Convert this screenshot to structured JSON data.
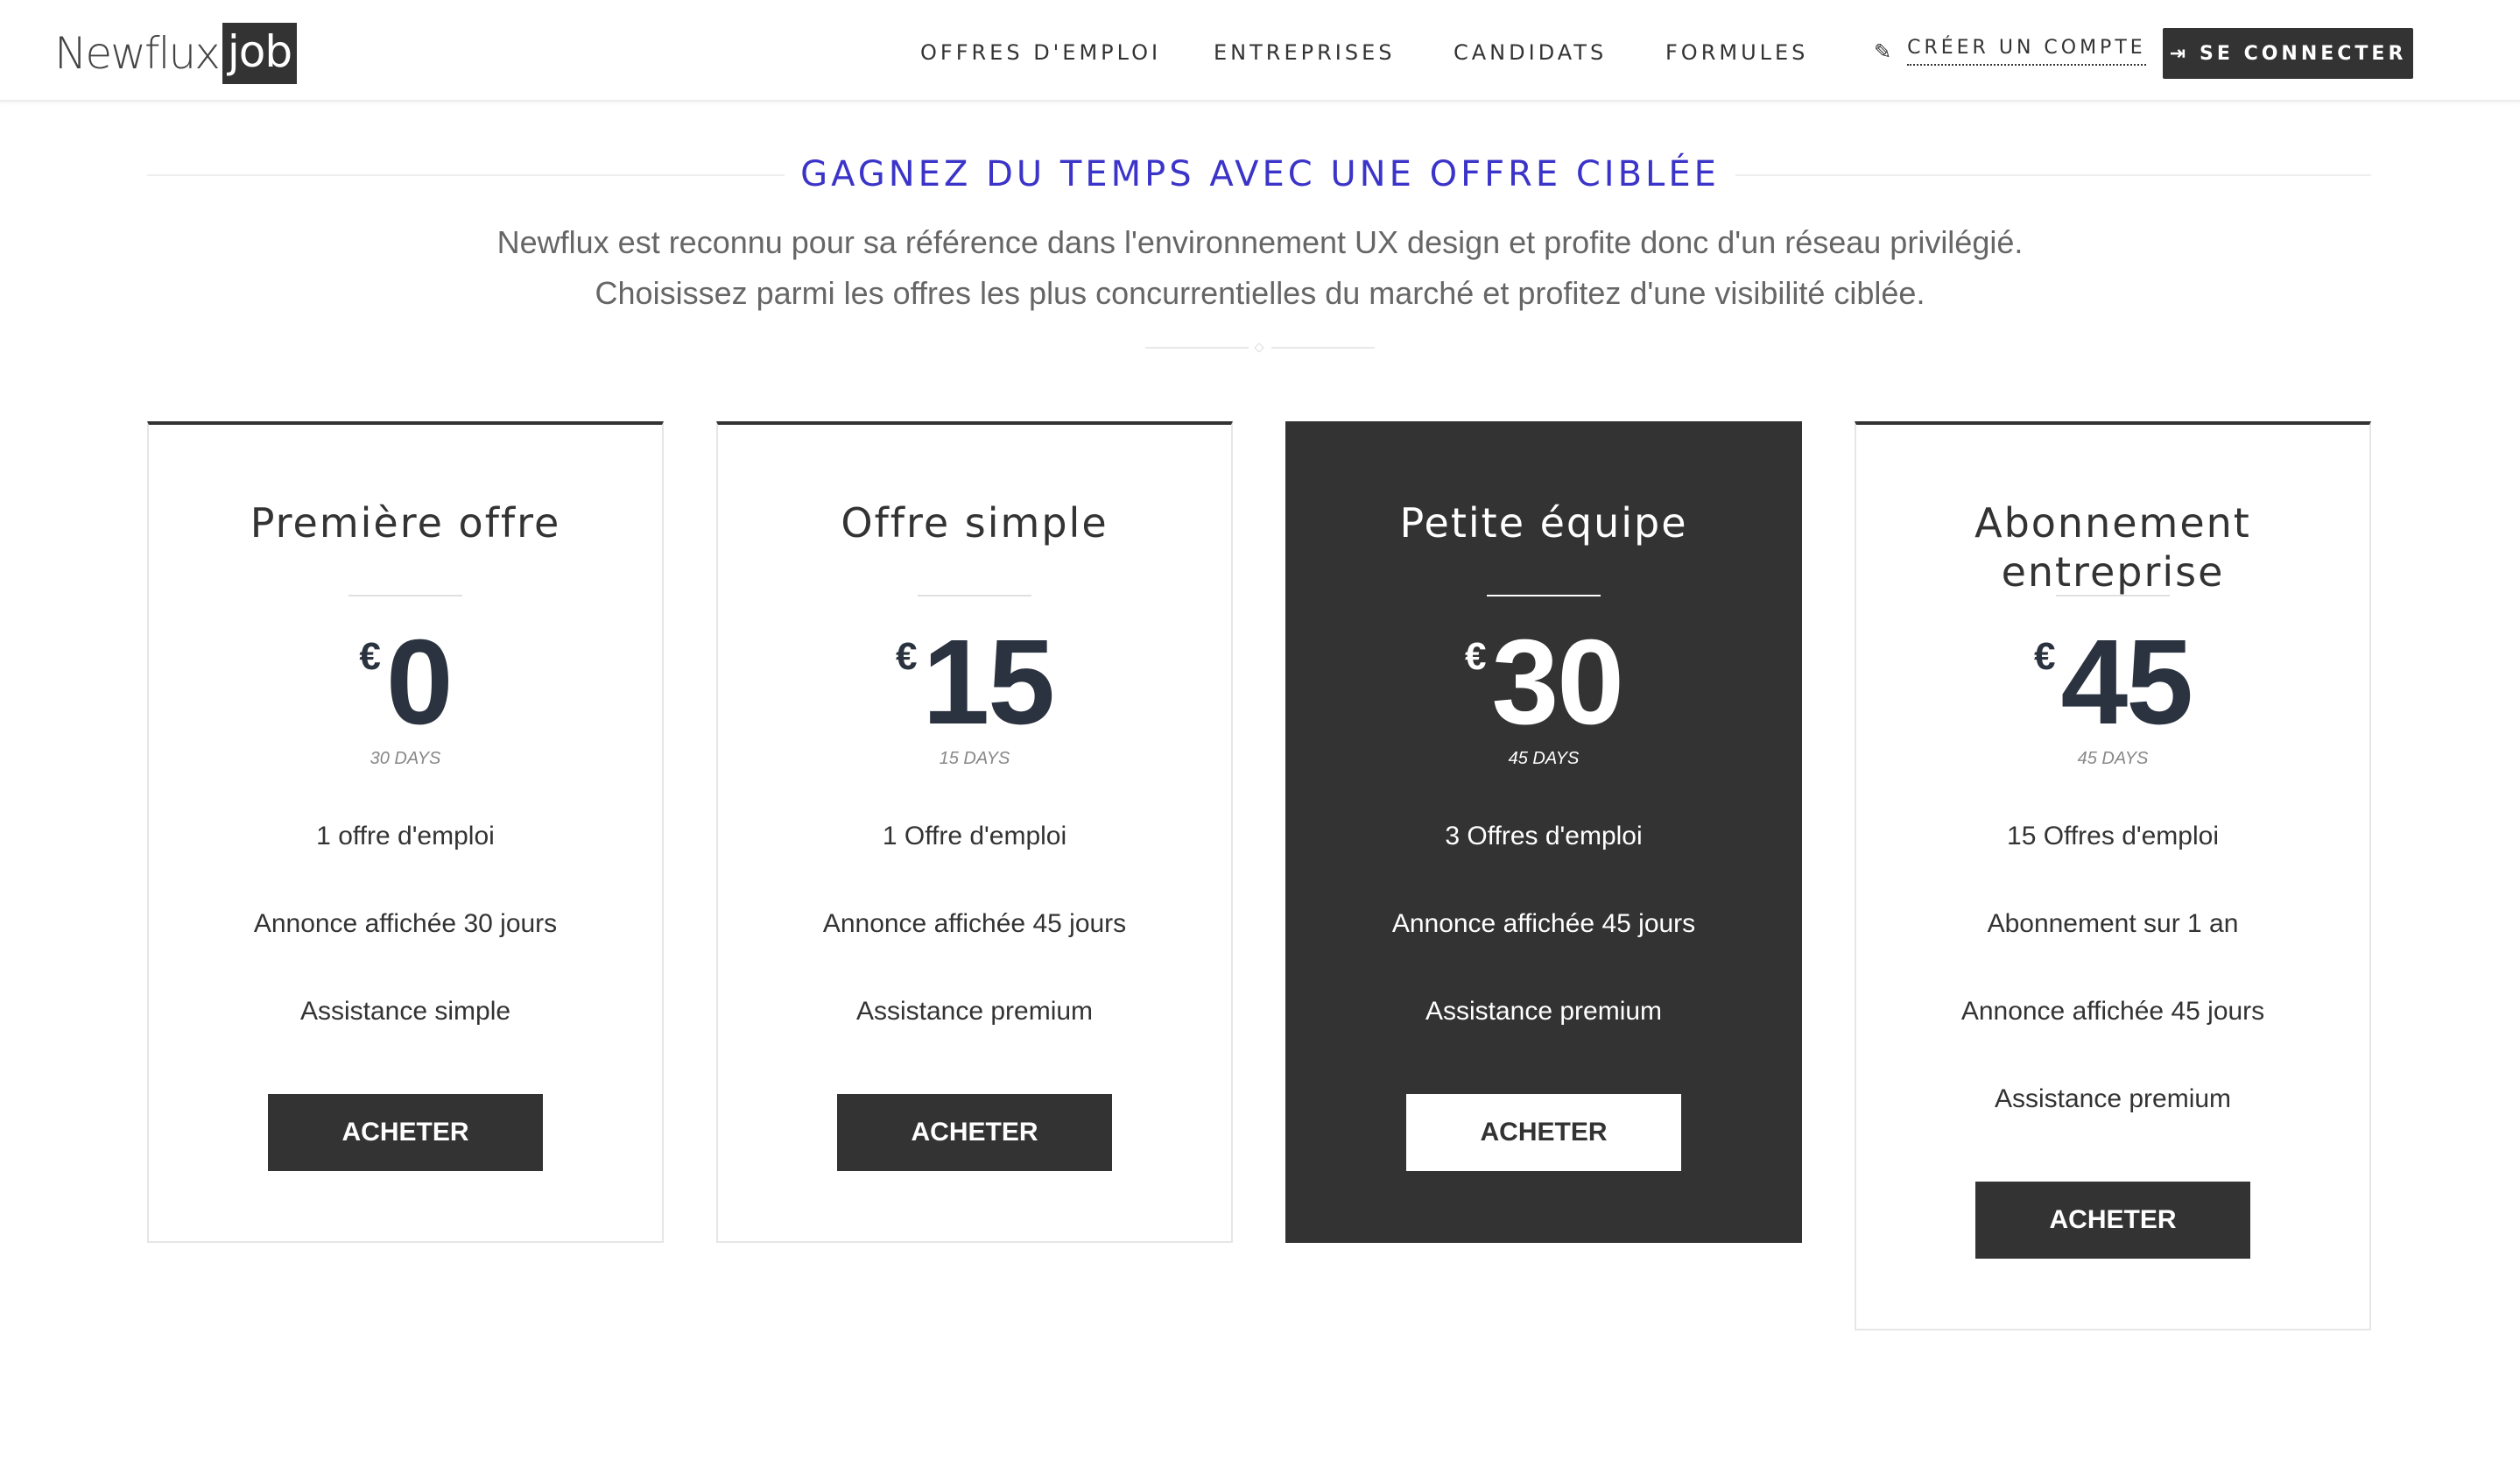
{
  "header": {
    "logo_text": "Newflux",
    "logo_box": "job",
    "nav": [
      "OFFRES D'EMPLOI",
      "ENTREPRISES",
      "CANDIDATS",
      "FORMULES"
    ],
    "create_account": "CRÉER UN COMPTE",
    "login": "SE CONNECTER"
  },
  "intro": {
    "title": "GAGNEZ DU TEMPS AVEC UNE OFFRE CIBLÉE",
    "line1": "Newflux est reconnu pour sa référence dans l'environnement UX design et profite donc d'un réseau privilégié.",
    "line2": "Choisissez parmi les offres les plus concurrentielles du marché et profitez d'une visibilité ciblée."
  },
  "plans": [
    {
      "title": "Première offre",
      "currency": "€",
      "amount": "0",
      "period": "30 DAYS",
      "features": [
        "1 offre d'emploi",
        "Annonce affichée 30 jours",
        "Assistance simple"
      ],
      "button": "ACHETER",
      "highlight": false
    },
    {
      "title": "Offre simple",
      "currency": "€",
      "amount": "15",
      "period": "15 DAYS",
      "features": [
        "1 Offre d'emploi",
        "Annonce affichée 45 jours",
        "Assistance premium"
      ],
      "button": "ACHETER",
      "highlight": false
    },
    {
      "title": "Petite équipe",
      "currency": "€",
      "amount": "30",
      "period": "45 DAYS",
      "features": [
        "3 Offres d'emploi",
        "Annonce affichée 45 jours",
        "Assistance premium"
      ],
      "button": "ACHETER",
      "highlight": true
    },
    {
      "title": "Abonnement entreprise",
      "currency": "€",
      "amount": "45",
      "period": "45 DAYS",
      "features": [
        "15 Offres d'emploi",
        "Abonnement sur 1 an",
        "Annonce affichée 45 jours",
        "Assistance premium"
      ],
      "button": "ACHETER",
      "highlight": false
    }
  ],
  "colors": {
    "accent": "#3b34c8",
    "dark": "#333333",
    "price": "#2b3340"
  }
}
